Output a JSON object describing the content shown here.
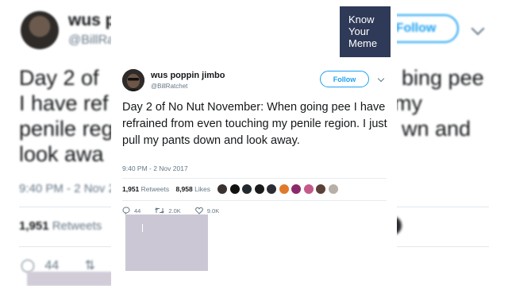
{
  "tweet": {
    "display_name": "wus poppin jimbo",
    "handle": "@BillRatchet",
    "follow_label": "Follow",
    "text": "Day 2 of No Nut November: When going pee I have refrained from even touching my penile region. I just pull my pants down and look away.",
    "timestamp": "9:40 PM - 2 Nov 2017",
    "retweets_count": "1,951",
    "retweets_label": "Retweets",
    "likes_count": "8,958",
    "likes_label": "Likes",
    "reply_count": "44",
    "retweet_action_count": "2.0K",
    "like_action_count": "9.0K",
    "accent_color": "#1da1f2"
  },
  "background": {
    "display_name_fragment": "wus p",
    "handle_fragment": "@BillRat",
    "follow_label": "Follow",
    "text_lines": [
      "Day 2 of",
      "I have ref",
      "penile regi",
      "look awa"
    ],
    "text_right_lines": [
      "bing pee",
      "my",
      "wn and"
    ],
    "timestamp_fragment": "9:40 PM - 2 Nov 2",
    "retweets_count": "1,951",
    "retweets_label": "Retweets",
    "reply_count": "44"
  },
  "watermark": {
    "lines": [
      "Know",
      "Your",
      "Meme"
    ],
    "color": "#2f3a58"
  },
  "liker_avatar_colors": [
    "#3a3230",
    "#111111",
    "#222a30",
    "#1a1a1a",
    "#2c2c34",
    "#e07a2b",
    "#8a2a6a",
    "#c45a8a",
    "#5a4038",
    "#b8b0a8"
  ]
}
